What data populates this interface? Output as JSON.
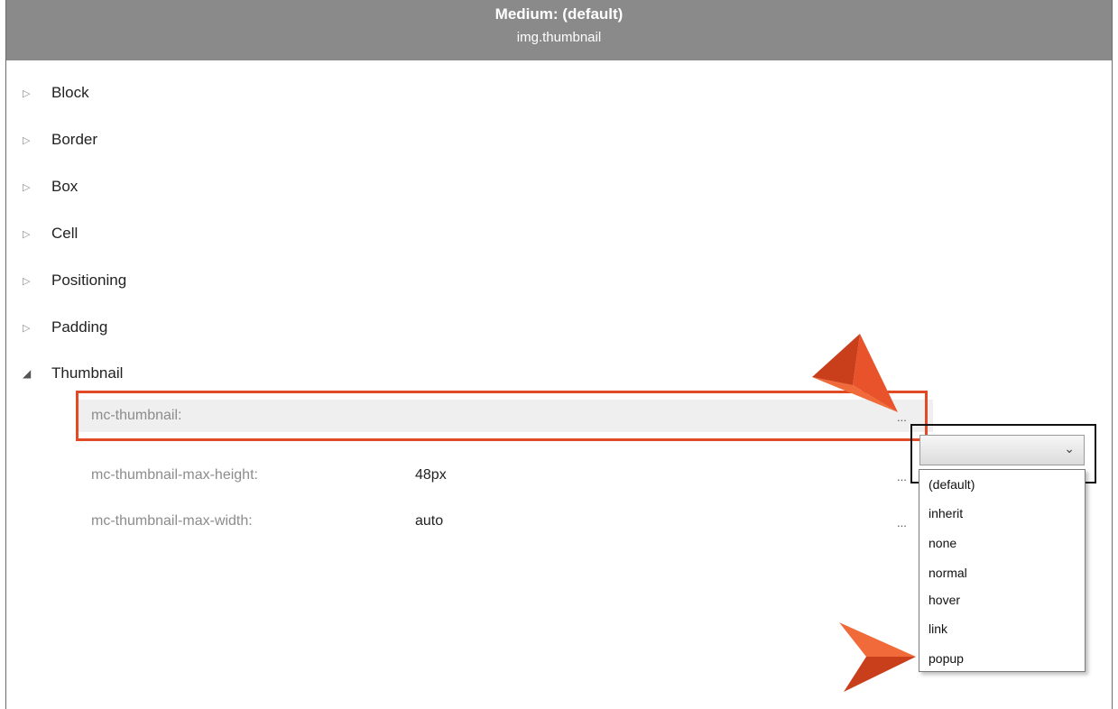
{
  "header": {
    "title": "Medium: (default)",
    "subtitle": "img.thumbnail"
  },
  "groups": [
    {
      "label": "Block",
      "expanded": false
    },
    {
      "label": "Border",
      "expanded": false
    },
    {
      "label": "Box",
      "expanded": false
    },
    {
      "label": "Cell",
      "expanded": false
    },
    {
      "label": "Positioning",
      "expanded": false
    },
    {
      "label": "Padding",
      "expanded": false
    },
    {
      "label": "Thumbnail",
      "expanded": true
    }
  ],
  "properties": [
    {
      "name": "mc-thumbnail:",
      "value": "",
      "dots": "..."
    },
    {
      "name": "mc-thumbnail-max-height:",
      "value": "48px",
      "dots": "..."
    },
    {
      "name": "mc-thumbnail-max-width:",
      "value": "auto",
      "dots": "..."
    }
  ],
  "dropdown": {
    "selected": "",
    "options": [
      "(default)",
      "inherit",
      "none",
      "normal",
      "hover",
      "link",
      "popup"
    ]
  },
  "icons": {
    "collapsed": "triangle-right-icon",
    "expanded": "triangle-down-icon",
    "combo": "chevron-down-icon"
  },
  "colors": {
    "header_bg": "#8a8a8a",
    "highlight": "#e24a26",
    "callout_arrow": "#e8532b"
  }
}
